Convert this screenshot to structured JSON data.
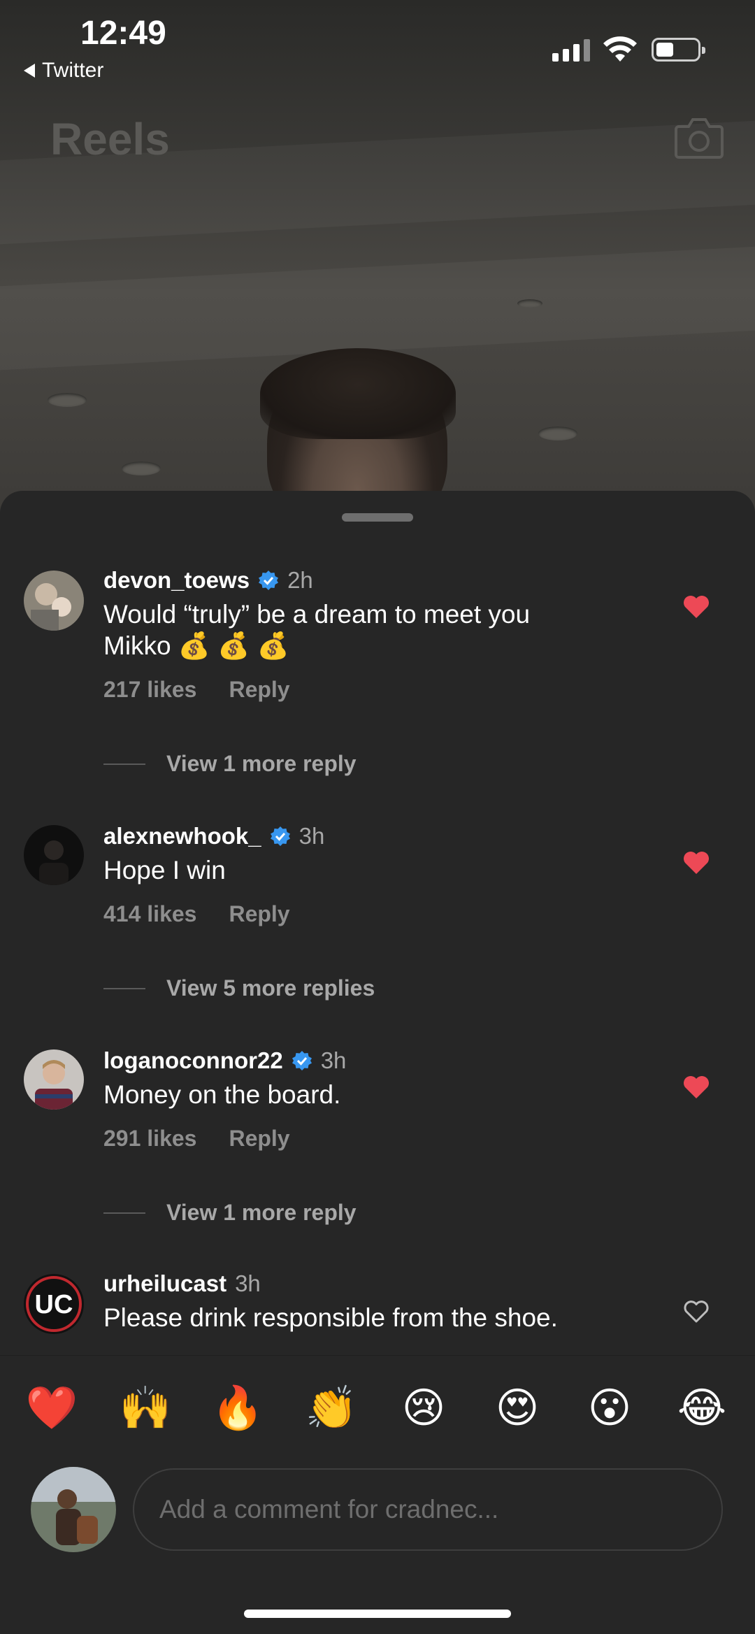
{
  "status_bar": {
    "time": "12:49",
    "back_app": "Twitter"
  },
  "header": {
    "title": "Reels",
    "camera_icon": "camera-icon"
  },
  "comments": [
    {
      "username": "devon_toews",
      "verified": true,
      "time": "2h",
      "text_line1": "Would “truly” be a dream to meet you",
      "text_line2": "Mikko 💰 💰 💰",
      "likes": "217 likes",
      "reply_label": "Reply",
      "liked": true,
      "view_replies": "View 1 more reply"
    },
    {
      "username": "alexnewhook_",
      "verified": true,
      "time": "3h",
      "text_line1": "Hope I win",
      "likes": "414 likes",
      "reply_label": "Reply",
      "liked": true,
      "view_replies": "View 5 more replies"
    },
    {
      "username": "loganoconnor22",
      "verified": true,
      "time": "3h",
      "text_line1": "Money on the board.",
      "likes": "291 likes",
      "reply_label": "Reply",
      "liked": true,
      "view_replies": "View 1 more reply"
    },
    {
      "username": "urheilucast",
      "verified": false,
      "time": "3h",
      "text_line1": "Please drink responsible from the shoe.",
      "liked": false
    }
  ],
  "emoji_bar": [
    "❤️",
    "🙌",
    "🔥",
    "👏",
    "😢",
    "😍",
    "😮",
    "😂"
  ],
  "composer": {
    "placeholder": "Add a comment for cradnec..."
  },
  "colors": {
    "sheet_bg": "#262626",
    "heart_red": "#ed4956",
    "verified_blue": "#3897f0",
    "secondary_text": "#8e8e8e"
  }
}
